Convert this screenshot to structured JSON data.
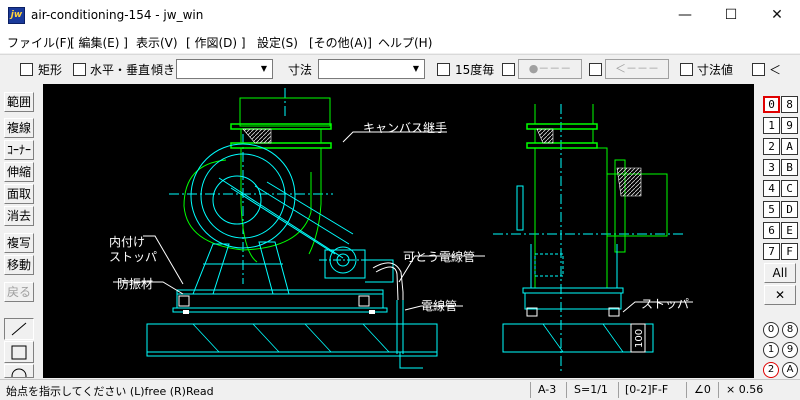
{
  "window": {
    "title": "air-conditioning-154 - jw_win",
    "icon": "jw",
    "minimize": "—",
    "maximize": "☐",
    "close": "✕"
  },
  "menu": [
    "ファイル(F)",
    "[ 編集(E) ]",
    "表示(V)",
    "[ 作図(D) ]",
    "設定(S)",
    "[その他(A)]",
    "ヘルプ(H)"
  ],
  "toolbar": {
    "rect_label": "矩形",
    "horiz_vert_label": "水平・垂直",
    "tilt_label": "傾き",
    "dimension_label": "寸法",
    "deg15_label": "15度毎",
    "dots_box": "●－－－",
    "arrow_box": "＜－－－",
    "dim_value_label": "寸法値",
    "lt_label": "＜"
  },
  "left_tools": [
    "範囲",
    "複線",
    "ｺｰﾅｰ",
    "伸縮",
    "面取",
    "消去",
    "複写",
    "移動",
    "戻る"
  ],
  "right_layers": {
    "left_col": [
      "0",
      "1",
      "2",
      "3",
      "4",
      "5",
      "6",
      "7"
    ],
    "right_col": [
      "8",
      "9",
      "A",
      "B",
      "C",
      "D",
      "E",
      "F"
    ],
    "all_label": "All",
    "x_label": "✕",
    "group_left": [
      "0",
      "1",
      "2"
    ],
    "group_right": [
      "8",
      "9",
      "A"
    ]
  },
  "drawing": {
    "labels": {
      "canvas_joint": "キャンバス継手",
      "inner_stopper_1": "内付け",
      "inner_stopper_2": "ストッパ",
      "vibration_material": "防振材",
      "flexible_conduit": "可とう電線管",
      "conduit": "電線管",
      "stopper_right": "ストッパ",
      "dim_100": "100"
    }
  },
  "statusbar": {
    "message": "始点を指示してください (L)free (R)Read",
    "paper": "A-3",
    "scale": "S=1/1",
    "layer": "[0-2]F-F",
    "angle": "∠0",
    "zoom": "× 0.56"
  },
  "colors": {
    "canvas_bg": "#000000",
    "cyan_lines": "#00ffff",
    "green_lines": "#00ff00",
    "white_text": "#ffffff",
    "active_layer_border": "#e00000"
  }
}
